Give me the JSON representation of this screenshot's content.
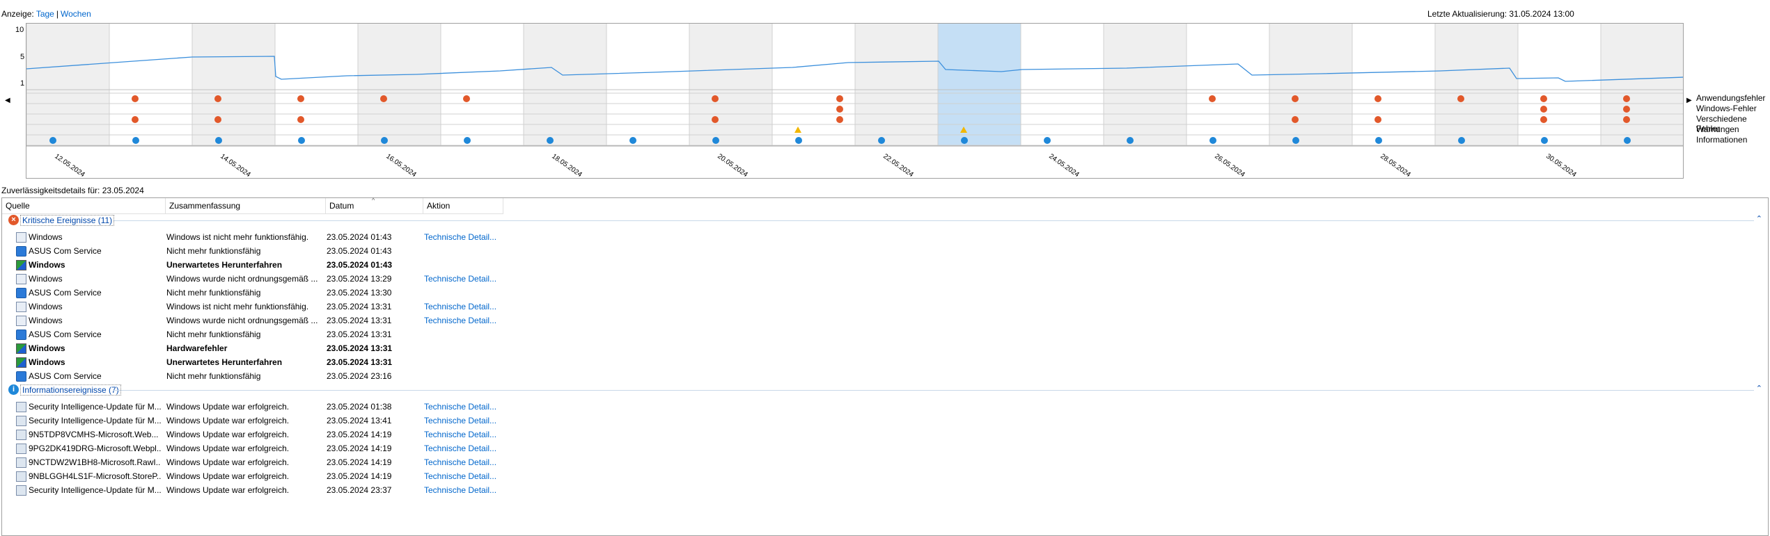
{
  "topbar": {
    "view_label": "Anzeige:",
    "view_days": "Tage",
    "view_weeks": "Wochen",
    "last_update": "Letzte Aktualisierung: 31.05.2024 13:00"
  },
  "chart": {
    "y_ticks": [
      "10",
      "5",
      "1"
    ],
    "row_labels": [
      "Anwendungsfehler",
      "Windows-Fehler",
      "Verschiedene Fehler",
      "Warnungen",
      "Informationen"
    ],
    "date_labels": [
      "12.05.2024",
      "14.05.2024",
      "16.05.2024",
      "18.05.2024",
      "20.05.2024",
      "22.05.2024",
      "24.05.2024",
      "26.05.2024",
      "28.05.2024",
      "30.05.2024"
    ],
    "selected_day_index": 11,
    "colors": {
      "line": "#3b8fdc",
      "selected": "#c5dff5",
      "shade": "#efefef",
      "error": "#e2582a",
      "warning": "#f2b701",
      "info": "#1f88d9"
    }
  },
  "details_title": "Zuverlässigkeitsdetails für: 23.05.2024",
  "columns": [
    "Quelle",
    "Zusammenfassung",
    "Datum",
    "Aktion"
  ],
  "groups": [
    {
      "label": "Kritische Ereignisse (11)",
      "icon": "error-icon",
      "rows": [
        {
          "icon": "app-icon",
          "source": "Windows",
          "summary": "Windows ist nicht mehr funktionsfähig.",
          "date": "23.05.2024 01:43",
          "action": "Technische Detail...",
          "bold": false
        },
        {
          "icon": "asus-icon",
          "source": "ASUS Com Service",
          "summary": "Nicht mehr funktionsfähig",
          "date": "23.05.2024 01:43",
          "action": "",
          "bold": false
        },
        {
          "icon": "windows-shield-icon",
          "source": "Windows",
          "summary": "Unerwartetes Herunterfahren",
          "date": "23.05.2024 01:43",
          "action": "",
          "bold": true
        },
        {
          "icon": "app-icon",
          "source": "Windows",
          "summary": "Windows wurde nicht ordnungsgemäß ...",
          "date": "23.05.2024 13:29",
          "action": "Technische Detail...",
          "bold": false
        },
        {
          "icon": "asus-icon",
          "source": "ASUS Com Service",
          "summary": "Nicht mehr funktionsfähig",
          "date": "23.05.2024 13:30",
          "action": "",
          "bold": false
        },
        {
          "icon": "app-icon",
          "source": "Windows",
          "summary": "Windows ist nicht mehr funktionsfähig.",
          "date": "23.05.2024 13:31",
          "action": "Technische Detail...",
          "bold": false
        },
        {
          "icon": "app-icon",
          "source": "Windows",
          "summary": "Windows wurde nicht ordnungsgemäß ...",
          "date": "23.05.2024 13:31",
          "action": "Technische Detail...",
          "bold": false
        },
        {
          "icon": "asus-icon",
          "source": "ASUS Com Service",
          "summary": "Nicht mehr funktionsfähig",
          "date": "23.05.2024 13:31",
          "action": "",
          "bold": false
        },
        {
          "icon": "windows-shield-icon",
          "source": "Windows",
          "summary": "Hardwarefehler",
          "date": "23.05.2024 13:31",
          "action": "",
          "bold": true
        },
        {
          "icon": "windows-shield-icon",
          "source": "Windows",
          "summary": "Unerwartetes Herunterfahren",
          "date": "23.05.2024 13:31",
          "action": "",
          "bold": true
        },
        {
          "icon": "asus-icon",
          "source": "ASUS Com Service",
          "summary": "Nicht mehr funktionsfähig",
          "date": "23.05.2024 23:16",
          "action": "",
          "bold": false
        }
      ]
    },
    {
      "label": "Informationsereignisse (7)",
      "icon": "info-icon",
      "rows": [
        {
          "icon": "update-icon",
          "source": "Security Intelligence-Update für M...",
          "summary": "Windows Update war erfolgreich.",
          "date": "23.05.2024 01:38",
          "action": "Technische Detail...",
          "bold": false
        },
        {
          "icon": "update-icon",
          "source": "Security Intelligence-Update für M...",
          "summary": "Windows Update war erfolgreich.",
          "date": "23.05.2024 13:41",
          "action": "Technische Detail...",
          "bold": false
        },
        {
          "icon": "update-icon",
          "source": "9N5TDP8VCMHS-Microsoft.Web...",
          "summary": "Windows Update war erfolgreich.",
          "date": "23.05.2024 14:19",
          "action": "Technische Detail...",
          "bold": false
        },
        {
          "icon": "update-icon",
          "source": "9PG2DK419DRG-Microsoft.Webpl...",
          "summary": "Windows Update war erfolgreich.",
          "date": "23.05.2024 14:19",
          "action": "Technische Detail...",
          "bold": false
        },
        {
          "icon": "update-icon",
          "source": "9NCTDW2W1BH8-Microsoft.RawI...",
          "summary": "Windows Update war erfolgreich.",
          "date": "23.05.2024 14:19",
          "action": "Technische Detail...",
          "bold": false
        },
        {
          "icon": "update-icon",
          "source": "9NBLGGH4LS1F-Microsoft.StoreP...",
          "summary": "Windows Update war erfolgreich.",
          "date": "23.05.2024 14:19",
          "action": "Technische Detail...",
          "bold": false
        },
        {
          "icon": "update-icon",
          "source": "Security Intelligence-Update für M...",
          "summary": "Windows Update war erfolgreich.",
          "date": "23.05.2024 23:37",
          "action": "Technische Detail...",
          "bold": false
        }
      ]
    }
  ]
}
